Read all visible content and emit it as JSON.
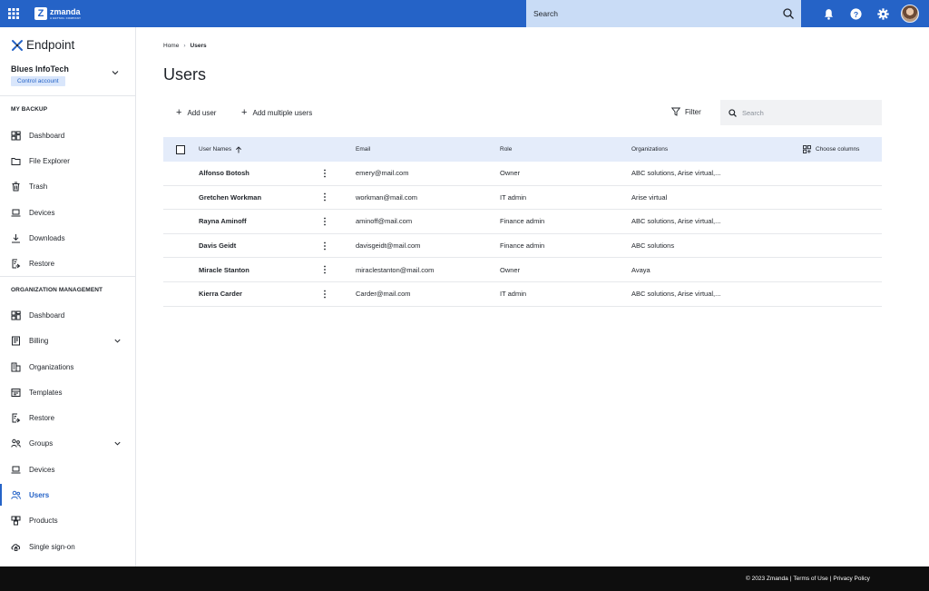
{
  "brand": {
    "name": "zmanda",
    "tagline": "A BETSOL COMPANY"
  },
  "topbar": {
    "search_label": "Search"
  },
  "sidebar": {
    "product": "Endpoint",
    "org_name": "Blues InfoTech",
    "org_badge": "Control account",
    "sections": [
      {
        "title": "MY BACKUP",
        "items": [
          "Dashboard",
          "File Explorer",
          "Trash",
          "Devices",
          "Downloads",
          "Restore"
        ]
      },
      {
        "title": "ORGANIZATION MANAGEMENT",
        "items": [
          "Dashboard",
          "Billing",
          "Organizations",
          "Templates",
          "Restore",
          "Groups",
          "Devices",
          "Users",
          "Products",
          "Single sign-on"
        ]
      }
    ]
  },
  "breadcrumb": {
    "home": "Home",
    "current": "Users"
  },
  "page": {
    "title": "Users"
  },
  "toolbar": {
    "add_user": "Add user",
    "add_multiple": "Add multiple users",
    "filter": "Filter",
    "search_placeholder": "Search"
  },
  "table": {
    "headers": {
      "name": "User Names",
      "email": "Email",
      "role": "Role",
      "orgs": "Organizations",
      "choose": "Choose columns"
    },
    "rows": [
      {
        "name": "Alfonso Botosh",
        "email": "emery@mail.com",
        "role": "Owner",
        "orgs": "ABC solutions, Arise virtual,..."
      },
      {
        "name": "Gretchen Workman",
        "email": "workman@mail.com",
        "role": "IT admin",
        "orgs": "Arise virtual"
      },
      {
        "name": "Rayna Aminoff",
        "email": "aminoff@mail.com",
        "role": "Finance admin",
        "orgs": "ABC solutions, Arise virtual,..."
      },
      {
        "name": "Davis Geidt",
        "email": "davisgeidt@mail.com",
        "role": "Finance admin",
        "orgs": "ABC solutions"
      },
      {
        "name": "Miracle Stanton",
        "email": "miraclestanton@mail.com",
        "role": "Owner",
        "orgs": "Avaya"
      },
      {
        "name": "Kierra Carder",
        "email": "Carder@mail.com",
        "role": "IT admin",
        "orgs": "ABC solutions, Arise virtual,..."
      }
    ]
  },
  "footer": {
    "copyright": "© 2023 Zmanda",
    "terms": "Terms of Use",
    "privacy": "Privacy Policy"
  },
  "colors": {
    "primary": "#2563c7",
    "header_row": "#e4ecfa",
    "search_bg": "#c9dcf6",
    "footer_bg": "#0e0e0e"
  }
}
